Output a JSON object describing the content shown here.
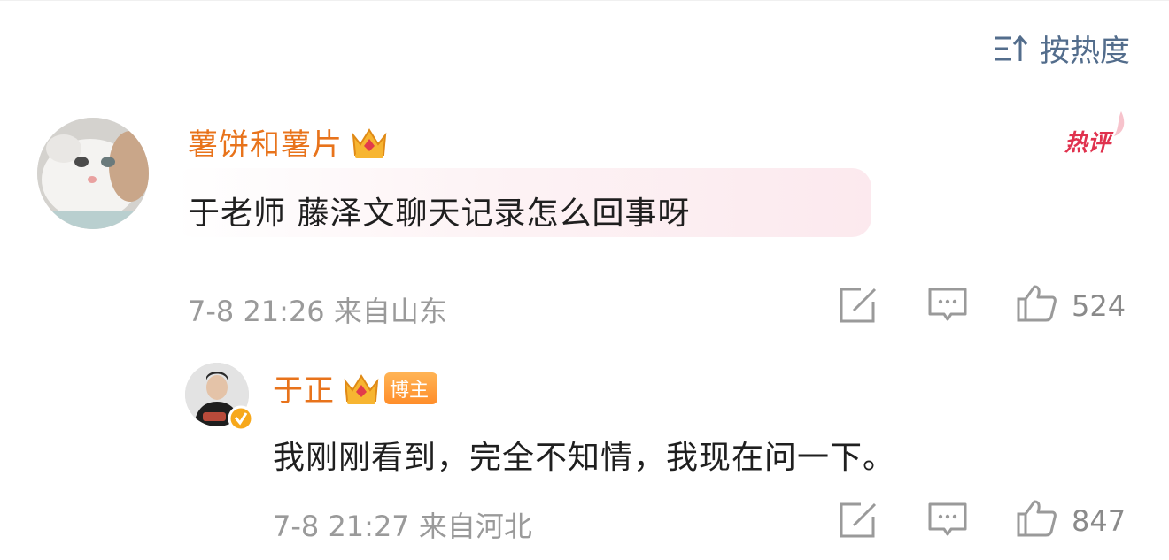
{
  "sort": {
    "icon": "sort-icon",
    "label": "按热度"
  },
  "comment": {
    "author": "薯饼和薯片",
    "badge": "hot-comment-badge",
    "badge_text": "热评",
    "text": "于老师 藤泽文聊天记录怎么回事呀",
    "time": "7-8 21:26",
    "location": "来自山东",
    "likes": "524",
    "colors": {
      "name": "#e8731b",
      "meta": "#9a9a9a"
    }
  },
  "reply": {
    "author": "于正",
    "tag": "博主",
    "text": "我刚刚看到，完全不知情，我现在问一下。",
    "time": "7-8 21:27",
    "location": "来自河北",
    "likes": "847"
  },
  "icons": [
    "repost-icon",
    "comment-icon",
    "like-icon",
    "crown-icon",
    "verified-icon"
  ],
  "accent": "#536d8c"
}
